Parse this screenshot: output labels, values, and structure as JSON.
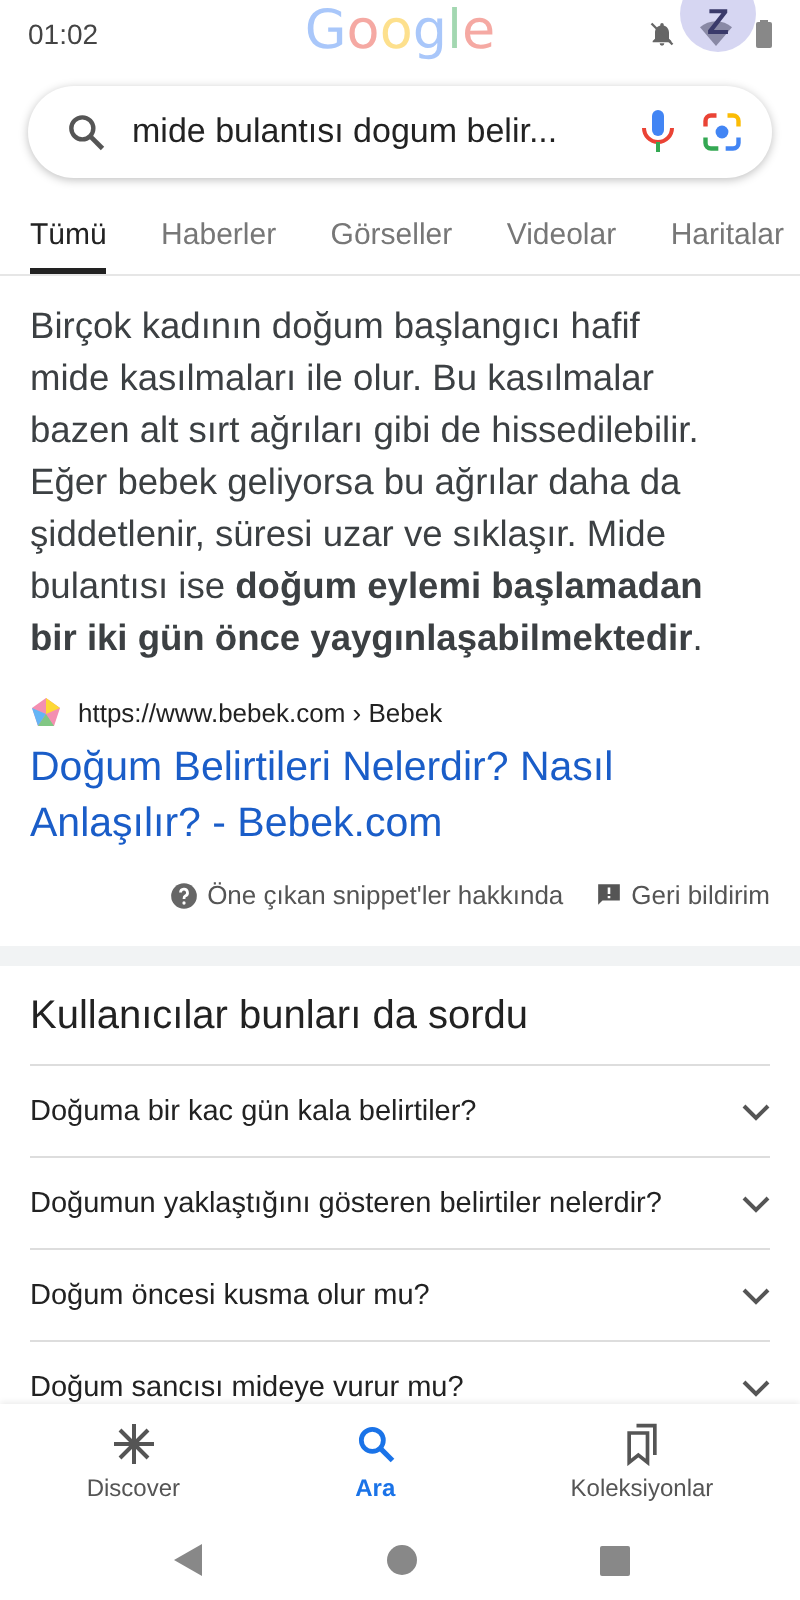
{
  "status_bar": {
    "time": "01:02"
  },
  "logo": "Google",
  "avatar": {
    "letter": "Z"
  },
  "search": {
    "value": "mide bulantısı dogum belir..."
  },
  "tabs": [
    {
      "label": "Tümü",
      "selected": true
    },
    {
      "label": "Haberler",
      "selected": false
    },
    {
      "label": "Görseller",
      "selected": false
    },
    {
      "label": "Videolar",
      "selected": false
    },
    {
      "label": "Haritalar",
      "selected": false
    }
  ],
  "snippet": {
    "text": "Birçok kadının doğum başlangıcı hafif mide kasılmaları ile olur. Bu kasılmalar bazen alt sırt ağrıları gibi de hissedilebilir. Eğer bebek geliyorsa bu ağrılar daha da şiddetlenir, süresi uzar ve sıklaşır. Mide bulantısı ise **doğum eylemi başlamadan bir iki gün önce yaygınlaşabilmektedir**.",
    "source": "https://www.bebek.com › Bebek",
    "title": "Doğum Belirtileri Nelerdir? Nasıl Anlaşılır? - Bebek.com",
    "about": "Öne çıkan snippet'ler hakkında",
    "feedback": "Geri bildirim"
  },
  "people_also_ask": {
    "heading": "Kullanıcılar bunları da sordu",
    "questions": [
      {
        "text": "Doğuma bir kac gün kala belirtiler?",
        "expanded": false
      },
      {
        "text": "Doğumun yaklaştığını gösteren belirtiler nelerdir?",
        "expanded": false
      },
      {
        "text": "Doğum öncesi kusma olur mu?",
        "expanded": false
      },
      {
        "text": "Doğum sancısı mideye vurur mu?",
        "expanded": false
      }
    ]
  },
  "bottom_nav": [
    {
      "label": "Discover",
      "selected": false
    },
    {
      "label": "Ara",
      "selected": true
    },
    {
      "label": "Koleksiyonlar",
      "selected": false
    }
  ]
}
